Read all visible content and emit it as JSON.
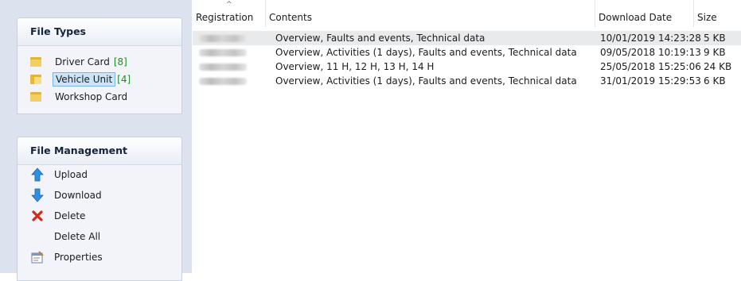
{
  "file_types": {
    "title": "File Types",
    "items": [
      {
        "label": "Driver Card",
        "count": "[8]",
        "selected": false
      },
      {
        "label": "Vehicle Unit",
        "count": "[4]",
        "selected": true
      },
      {
        "label": "Workshop Card",
        "count": "",
        "selected": false
      }
    ]
  },
  "file_management": {
    "title": "File Management",
    "items": [
      {
        "label": "Upload",
        "icon": "upload-arrow-icon"
      },
      {
        "label": "Download",
        "icon": "download-arrow-icon"
      },
      {
        "label": "Delete",
        "icon": "delete-x-icon"
      },
      {
        "label": "Delete All",
        "icon": ""
      },
      {
        "label": "Properties",
        "icon": "properties-icon"
      }
    ]
  },
  "table": {
    "columns": [
      "Registration",
      "Contents",
      "Download Date",
      "Size"
    ],
    "sort_indicator": "^",
    "rows": [
      {
        "contents": "Overview, Faults and events, Technical data",
        "download_date": "10/01/2019 14:23:28",
        "size": "5 KB",
        "selected": true
      },
      {
        "contents": "Overview, Activities (1 days), Faults and events, Technical data",
        "download_date": "09/05/2018 10:19:13",
        "size": "9 KB",
        "selected": false
      },
      {
        "contents": "Overview, 11 H, 12 H, 13 H, 14 H",
        "download_date": "25/05/2018 15:25:06",
        "size": "24 KB",
        "selected": false
      },
      {
        "contents": "Overview, Activities (1 days), Faults and events, Technical data",
        "download_date": "31/01/2019 15:29:53",
        "size": "6 KB",
        "selected": false
      }
    ]
  },
  "colors": {
    "sidebar_bg": "#dde3ee",
    "selection_bg": "#cce4f7",
    "count_green": "#1e8f1e",
    "row_selected_bg": "#e9eaec",
    "upload_blue": "#2f8fe0",
    "delete_red": "#d42a1c"
  }
}
